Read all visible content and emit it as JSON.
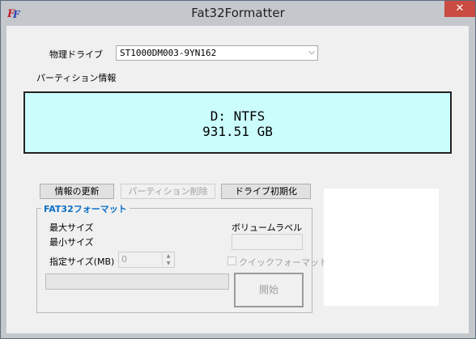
{
  "window": {
    "title": "Fat32Formatter",
    "close_label": "✕"
  },
  "drive": {
    "label": "物理ドライブ",
    "selected": "ST1000DM003-9YN162"
  },
  "partition": {
    "label": "パーティション情報",
    "line1": "D: NTFS",
    "line2": "931.51 GB"
  },
  "buttons": {
    "refresh": "情報の更新",
    "delete_partition": "パーティション削除",
    "init_drive": "ドライブ初期化"
  },
  "fat32": {
    "group_title": "FAT32フォーマット",
    "max_size_label": "最大サイズ",
    "min_size_label": "最小サイズ",
    "size_label": "指定サイズ(MB)",
    "size_value": "0",
    "volume_label": "ボリュームラベル",
    "quick_format_label": "クイックフォーマット",
    "start_label": "開始"
  },
  "colors": {
    "info_bg": "#cbfdfd",
    "group_title": "#0b6fc6",
    "close": "#c94b41"
  }
}
